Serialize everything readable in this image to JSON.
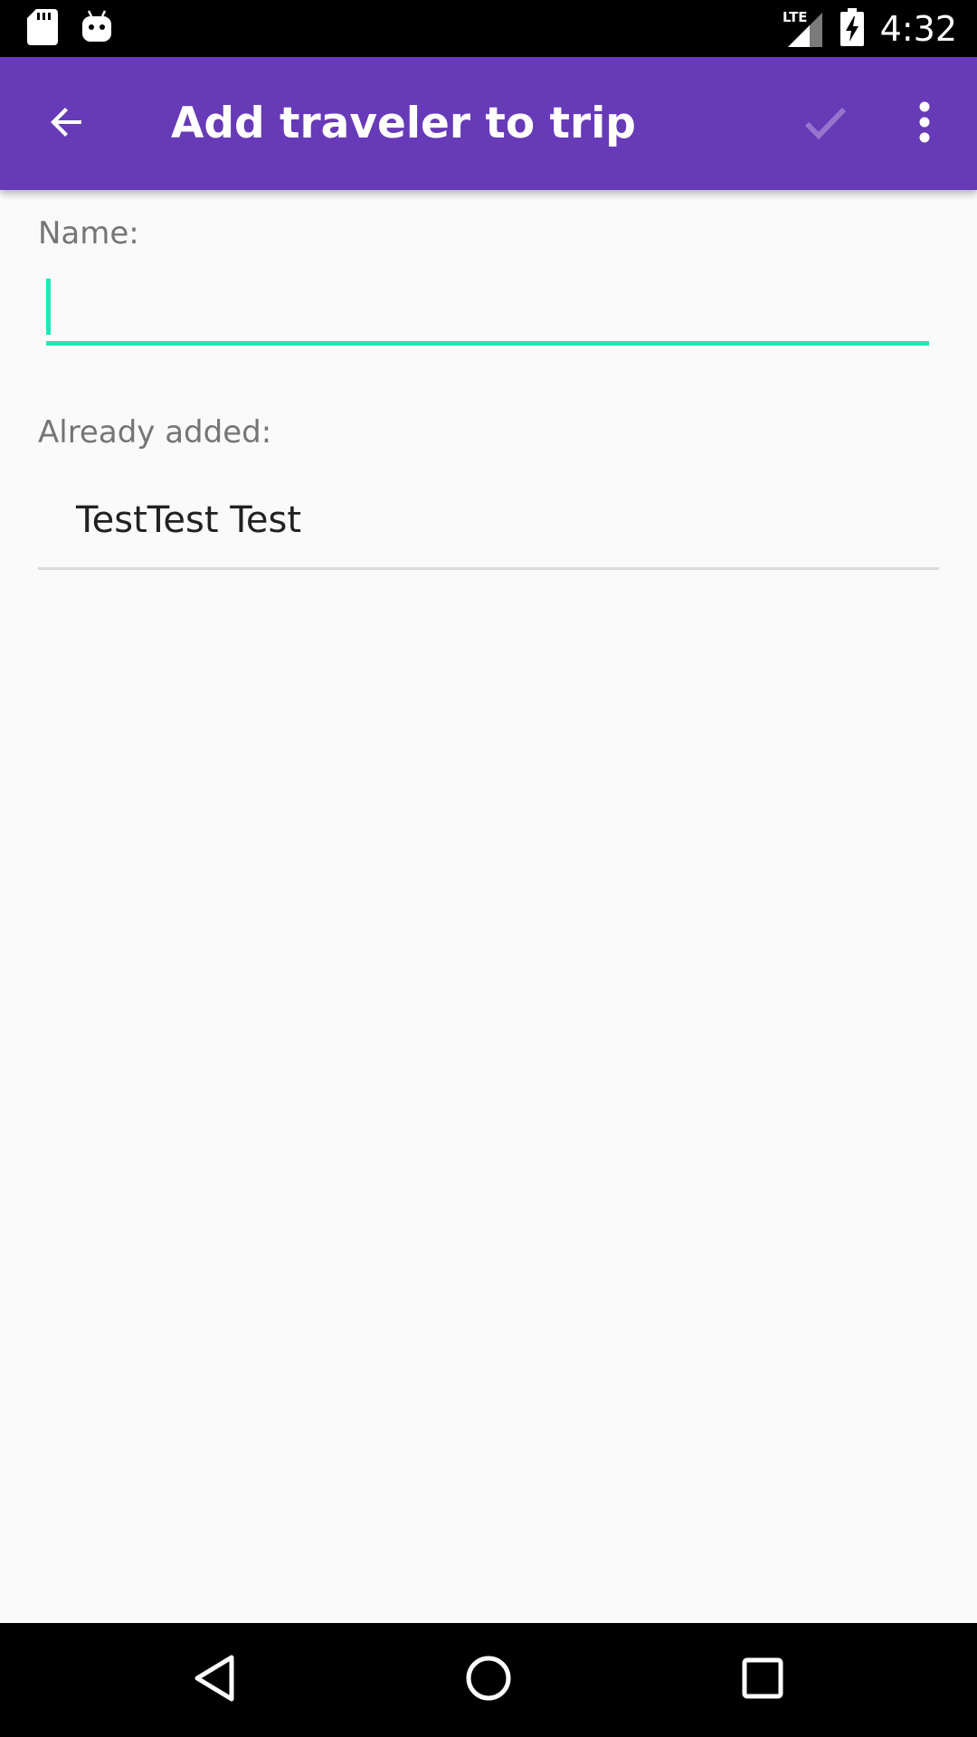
{
  "status_bar": {
    "network": "LTE",
    "time": "4:32",
    "left_icons": [
      "sd-card-icon",
      "android-icon"
    ],
    "right_icons": [
      "lte-signal-icon",
      "battery-charging-icon"
    ]
  },
  "app_bar": {
    "title": "Add traveler to trip",
    "back_icon": "arrow-back-icon",
    "confirm_icon": "check-icon",
    "overflow_icon": "more-vert-icon",
    "color": "#673ab7"
  },
  "form": {
    "name_label": "Name:",
    "name_value": "",
    "accent_color": "#1de9b6"
  },
  "travelers": {
    "label": "Already added:",
    "items": [
      {
        "name": "TestTest Test"
      }
    ]
  },
  "nav_bar": {
    "icons": [
      "nav-back-icon",
      "nav-home-icon",
      "nav-recents-icon"
    ]
  }
}
